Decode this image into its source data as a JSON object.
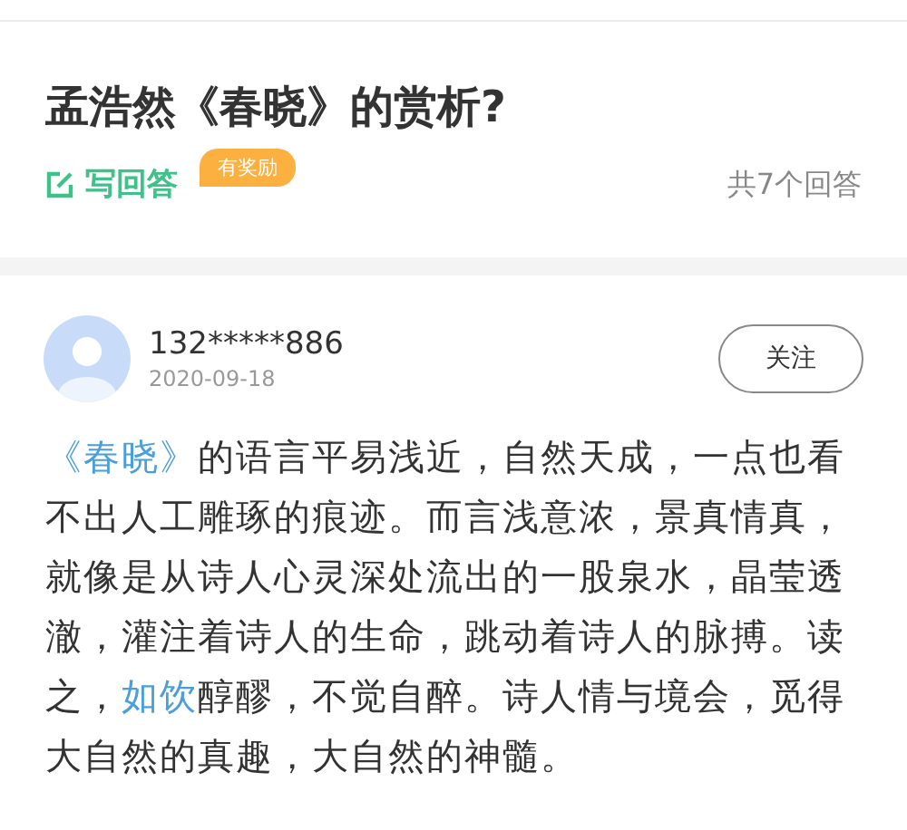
{
  "question": {
    "title": "孟浩然《春晓》的赏析?",
    "write_answer": "写回答",
    "reward_badge": "有奖励",
    "answer_count": "共7个回答"
  },
  "answers": [
    {
      "user": "132*****886",
      "date": "2020-09-18",
      "follow": "关注",
      "body": [
        {
          "kind": "link",
          "text": "《春晓》"
        },
        {
          "kind": "text",
          "text": "的语言平易浅近，自然天成，一点也看不出人工雕琢的痕迹。而言浅意浓，景真情真，就像是从诗人心灵深处流出的一股泉水，晶莹透澈，灌注着诗人的生命，跳动着诗人的脉搏。读之，"
        },
        {
          "kind": "link",
          "text": "如饮"
        },
        {
          "kind": "text",
          "text": "醇醪，不觉自醉。诗人情与境会，觅得大自然的真趣，大自然的神髓。"
        }
      ]
    }
  ]
}
